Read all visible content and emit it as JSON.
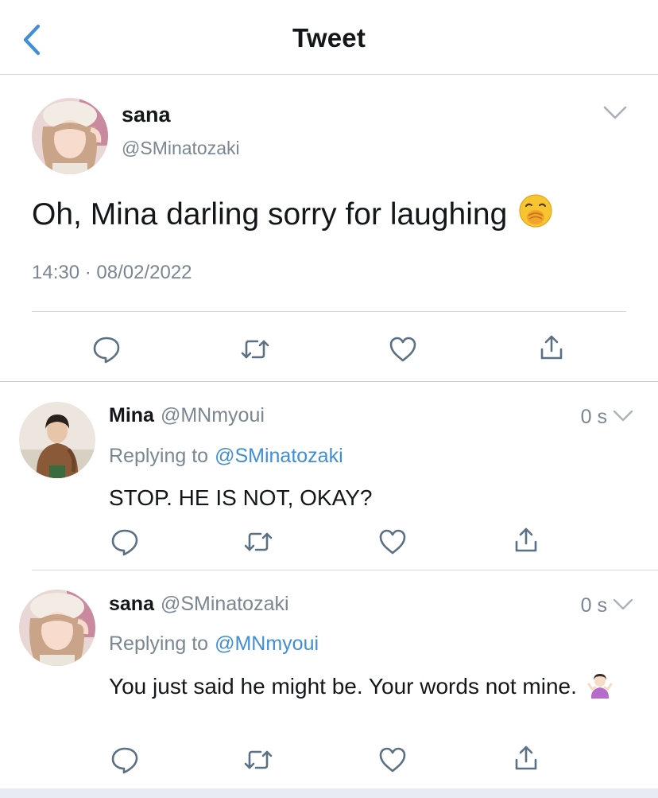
{
  "header": {
    "title": "Tweet",
    "back_icon": "chevron-left-icon"
  },
  "colors": {
    "accent": "#3f8ed6",
    "secondary_text": "#7a8691",
    "divider": "#d5d8db"
  },
  "main_tweet": {
    "name": "sana",
    "handle": "@SMinatozaki",
    "text": "Oh, Mina darling sorry for laughing",
    "emoji": "hand-over-mouth-emoji",
    "time": "14:30",
    "separator": "·",
    "date": "08/02/2022",
    "actions": [
      "reply-icon",
      "retweet-icon",
      "like-icon",
      "share-icon"
    ]
  },
  "replies": [
    {
      "name": "Mina",
      "handle": "@MNmyoui",
      "time": "0 s",
      "replying_prefix": "Replying to",
      "replying_to": "@SMinatozaki",
      "text": "STOP. HE IS NOT, OKAY?"
    },
    {
      "name": "sana",
      "handle": "@SMinatozaki",
      "time": "0 s",
      "replying_prefix": "Replying to",
      "replying_to": "@MNmyoui",
      "text": "You just said he might be. Your words not mine.",
      "emoji": "person-shrugging-emoji"
    }
  ]
}
